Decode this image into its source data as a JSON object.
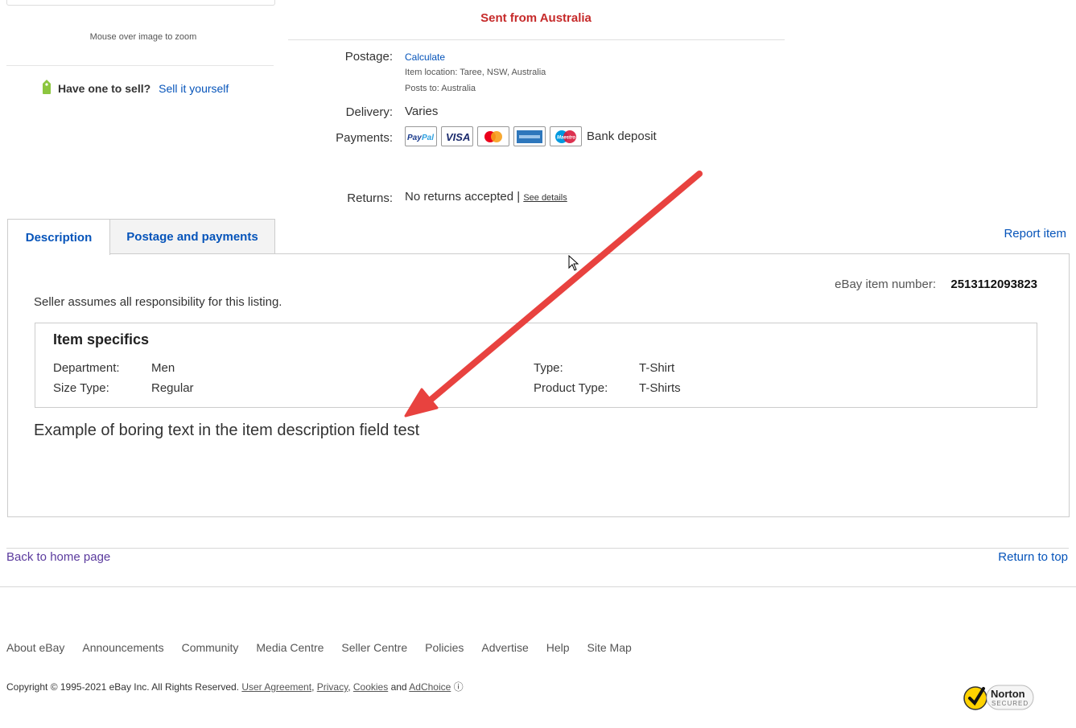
{
  "left": {
    "zoom_hint": "Mouse over image to zoom",
    "sell_question": "Have one to sell?",
    "sell_link": "Sell it yourself"
  },
  "shipping": {
    "sent_from": "Sent from Australia",
    "postage_label": "Postage:",
    "calculate_link": "Calculate",
    "item_location": "Item location:  Taree, NSW, Australia",
    "posts_to": "Posts to:  Australia",
    "delivery_label": "Delivery:",
    "delivery_value": "Varies",
    "payments_label": "Payments:",
    "payment_methods": [
      "paypal-icon",
      "visa-icon",
      "mastercard-icon",
      "amex-icon",
      "maestro-icon"
    ],
    "bank_deposit": "Bank deposit",
    "returns_label": "Returns:",
    "returns_value": "No returns accepted |",
    "see_details": "See details"
  },
  "tabs": [
    {
      "label": "Description",
      "active": true
    },
    {
      "label": "Postage and payments",
      "active": false
    }
  ],
  "report_item": "Report item",
  "description": {
    "item_number_label": "eBay item number:",
    "item_number": "2513112093823",
    "responsibility": "Seller assumes all responsibility for this listing.",
    "specifics_title": "Item specifics",
    "specifics": [
      {
        "label": "Department:",
        "value": "Men"
      },
      {
        "label": "Size Type:",
        "value": "Regular"
      },
      {
        "label": "Type:",
        "value": "T-Shirt"
      },
      {
        "label": "Product Type:",
        "value": "T-Shirts"
      }
    ],
    "body_text": "Example of boring text in the item description field test"
  },
  "nav": {
    "back_home": "Back to home page",
    "return_top": "Return to top"
  },
  "footer": {
    "links": [
      "About eBay",
      "Announcements",
      "Community",
      "Media Centre",
      "Seller Centre",
      "Policies",
      "Advertise",
      "Help",
      "Site Map"
    ],
    "copyright": "Copyright © 1995-2021 eBay Inc. All Rights Reserved.",
    "user_agreement": "User Agreement",
    "privacy": "Privacy",
    "cookies": "Cookies",
    "and": "and",
    "adchoice": "AdChoice",
    "norton_text": "Norton",
    "norton_sub": "SECURED"
  },
  "colors": {
    "link_blue": "#0654ba",
    "sent_red": "#c62a2a",
    "visited_purple": "#5b3b9e",
    "arrow_red": "#e8423f"
  }
}
